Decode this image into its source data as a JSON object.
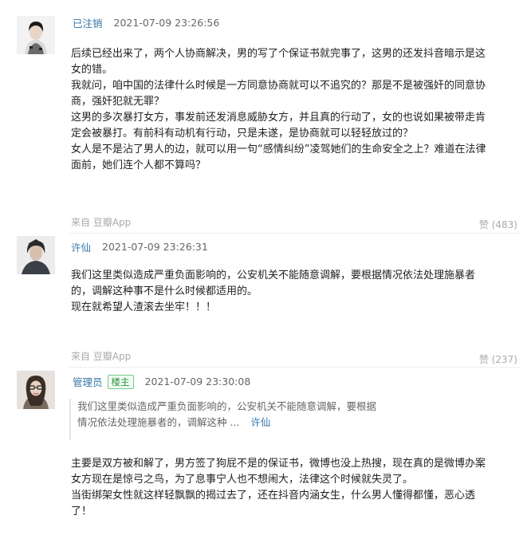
{
  "comments": [
    {
      "author": "已注销",
      "time": "2021-07-09 23:26:56",
      "lines": [
        "后续已经出来了，两个人协商解决，男的写了个保证书就完事了，这男的还发抖音暗示是这",
        "女的错。",
        "我就问，咱中国的法律什么时候是一方同意协商就可以不追究的？那是不是被强奸的同意协",
        "商，强奸犯就无罪？",
        "这男的多次暴打女方，事发前还发消息威胁女方，并且真的行动了，女的也说如果被带走肯",
        "定会被暴打。有前科有动机有行动，只是未遂，是协商就可以轻轻放过的？",
        "女人是不是沾了男人的边，就可以用一句“感情纠纷”凌驾她们的生命安全之上？难道在法律",
        "面前，她们连个人都不算吗？"
      ],
      "source": "来自 豆瓣App",
      "likes": "赞 (483)"
    },
    {
      "author": "许仙",
      "time": "2021-07-09 23:26:31",
      "lines": [
        "我们这里类似造成严重负面影响的，公安机关不能随意调解，要根据情况依法处理施暴者",
        "的，调解这种事不是什么时候都适用的。",
        "现在就希望人渣滚去坐牢！！！"
      ],
      "source": "来自 豆瓣App",
      "likes": "赞 (237)"
    },
    {
      "author": "管理员",
      "badge": "楼主",
      "time": "2021-07-09 23:30:08",
      "quote": {
        "lines": [
          "我们这里类似造成严重负面影响的，公安机关不能随意调解，要根据",
          "情况依法处理施暴者的，调解这种 ..."
        ],
        "author": "许仙"
      },
      "lines": [
        "主要是双方被和解了，男方签了狗屁不是的保证书，微博也没上热搜，现在真的是微博办案",
        "女方现在是惊弓之鸟，为了息事宁人也不想闹大，法律这个时候就失灵了。",
        "当街绑架女性就这样轻飘飘的揭过去了，还在抖音内涵女生，什么男人懂得都懂，恶心透",
        "了！"
      ]
    }
  ]
}
